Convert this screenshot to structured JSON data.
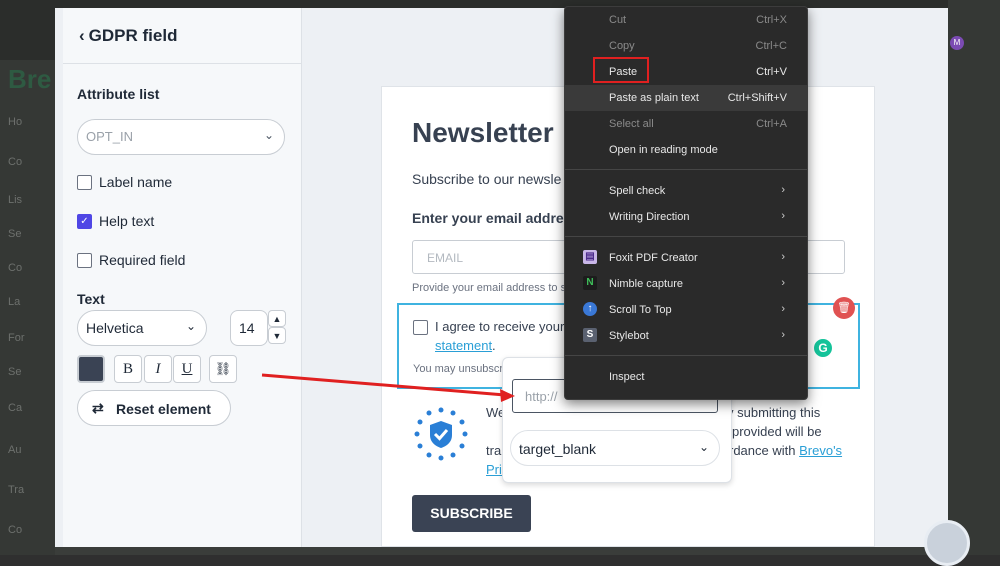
{
  "background": {
    "brand_letters": "Bre",
    "nav": [
      "Ho",
      "Co",
      "Lis",
      "Se",
      "Co",
      "La",
      "For",
      "Se",
      "Ca",
      "Au",
      "Tra",
      "Co"
    ],
    "avatar_letter": "M"
  },
  "panel": {
    "title": "GDPR field",
    "attribute_list_label": "Attribute list",
    "attribute_value": "OPT_IN",
    "checkbox_label_name": "Label name",
    "checkbox_help_text": "Help text",
    "checkbox_required": "Required field",
    "text_label": "Text",
    "font_value": "Helvetica",
    "font_size": "14",
    "bold": "B",
    "italic": "I",
    "underline": "U",
    "reset_label": "Reset element"
  },
  "form": {
    "title": "Newsletter",
    "subtitle": "Subscribe to our newsle",
    "email_label": "Enter your email addre",
    "email_placeholder": "EMAIL",
    "email_hint": "Provide your email address to s",
    "agree_text": "I agree to receive your",
    "statement": "statement",
    "unsub": "You may unsubscri",
    "we": "We",
    "tran": "tran",
    "priv": "Priv",
    "right1": "y submitting this",
    "right2": "provided will be",
    "right3": "rdance with",
    "brevo_link": "Brevo's",
    "subscribe": "SUBSCRIBE"
  },
  "popover": {
    "url_placeholder": "http://",
    "target_value": "target_blank"
  },
  "context_menu": {
    "cut": "Cut",
    "cut_key": "Ctrl+X",
    "copy": "Copy",
    "copy_key": "Ctrl+C",
    "paste": "Paste",
    "paste_key": "Ctrl+V",
    "paste_plain": "Paste as plain text",
    "paste_plain_key": "Ctrl+Shift+V",
    "select_all": "Select all",
    "select_all_key": "Ctrl+A",
    "reading_mode": "Open in reading mode",
    "spell_check": "Spell check",
    "writing_direction": "Writing Direction",
    "foxit": "Foxit PDF Creator",
    "nimble": "Nimble capture",
    "scroll_top": "Scroll To Top",
    "stylebot": "Stylebot",
    "inspect": "Inspect"
  },
  "colors": {
    "accent_red": "#e02020",
    "focus_blue": "#3fb3e0",
    "button_dark": "#3a4354",
    "checkbox_on": "#4f46e5"
  }
}
